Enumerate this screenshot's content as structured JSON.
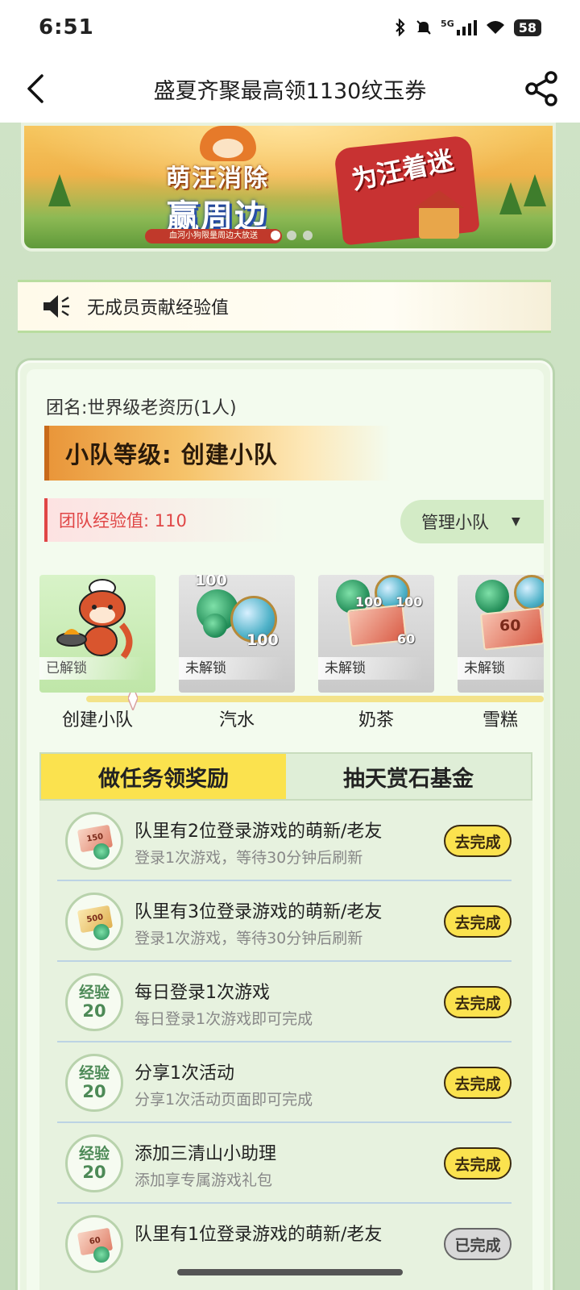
{
  "status_bar": {
    "time": "6:51",
    "network": "5G",
    "battery": "58"
  },
  "nav": {
    "title": "盛夏齐聚最高领1130纹玉券",
    "back_icon": "back-arrow-icon",
    "share_icon": "share-icon"
  },
  "banner": {
    "title_line1": "萌汪消除",
    "title_line2": "赢周边",
    "subtitle": "血河小狗限量周边大放送",
    "bag_text": "为汪着迷",
    "slides": 3,
    "active_slide": 0
  },
  "notice": {
    "text": "暂无成员贡献经验值",
    "visible_text": "无成员贡献经验值"
  },
  "team": {
    "name": "团名:世界级老资历(1人)",
    "level": "小队等级: 创建小队",
    "exp": "团队经验值: 110",
    "manage_label": "管理小队",
    "manage_arrow": "▼"
  },
  "rewards": [
    {
      "label": "创建小队",
      "status": "已解锁",
      "unlocked": true
    },
    {
      "label": "汽水",
      "status": "未解锁",
      "unlocked": false,
      "values": [
        "100",
        "100"
      ]
    },
    {
      "label": "奶茶",
      "status": "未解锁",
      "unlocked": false,
      "values": [
        "100",
        "100",
        "60"
      ]
    },
    {
      "label": "雪糕",
      "status": "未解锁",
      "unlocked": false,
      "values": [
        "60"
      ]
    }
  ],
  "tabs": [
    {
      "label": "做任务领奖励",
      "active": true
    },
    {
      "label": "抽天赏石基金",
      "active": false
    }
  ],
  "tasks": [
    {
      "icon_type": "ticket",
      "icon_text": "150",
      "title": "队里有2位登录游戏的萌新/老友",
      "desc": "登录1次游戏，等待30分钟后刷新",
      "button": "去完成",
      "done": false
    },
    {
      "icon_type": "ticket",
      "icon_text": "500",
      "title": "队里有3位登录游戏的萌新/老友",
      "desc": "登录1次游戏，等待30分钟后刷新",
      "button": "去完成",
      "done": false
    },
    {
      "icon_type": "exp",
      "icon_l1": "经验",
      "icon_l2": "20",
      "title": "每日登录1次游戏",
      "desc": "每日登录1次游戏即可完成",
      "button": "去完成",
      "done": false
    },
    {
      "icon_type": "exp",
      "icon_l1": "经验",
      "icon_l2": "20",
      "title": "分享1次活动",
      "desc": "分享1次活动页面即可完成",
      "button": "去完成",
      "done": false
    },
    {
      "icon_type": "exp",
      "icon_l1": "经验",
      "icon_l2": "20",
      "title": "添加三清山小助理",
      "desc": "添加享专属游戏礼包",
      "button": "去完成",
      "done": false
    },
    {
      "icon_type": "ticket",
      "icon_text": "60",
      "title": "队里有1位登录游戏的萌新/老友",
      "desc": "",
      "button": "已完成",
      "done": true
    }
  ]
}
